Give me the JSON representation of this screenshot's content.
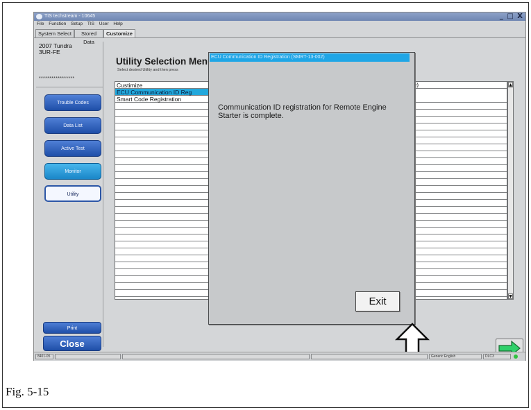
{
  "window": {
    "title": "TIS techstream - 10645",
    "controls": "_ □ X"
  },
  "menu": [
    "File",
    "Function",
    "Setup",
    "TIS",
    "User",
    "Help"
  ],
  "tabs": [
    "System Select",
    "Stored Data",
    "Customize"
  ],
  "vehicle": {
    "model": "2007 Tundra",
    "engine": "3UR-FE",
    "vin": "*****************"
  },
  "left_buttons": {
    "trouble_codes": "Trouble Codes",
    "data_list": "Data List",
    "active_test": "Active Test",
    "monitor": "Monitor",
    "utility": "Utility",
    "print": "Print",
    "close": "Close"
  },
  "utility": {
    "title": "Utility Selection Menu",
    "subtitle": "Select desired Utility and then press"
  },
  "list_items": [
    "Custimize",
    "ECU Communication ID Reg",
    "Smart Code Registration"
  ],
  "mode_text": "Mode)",
  "dialog": {
    "title": "ECU Communication ID Registration (SMRT-13-002)",
    "message": "Communication ID registration for Remote Engine Starter is complete.",
    "exit_label": "Exit"
  },
  "status": {
    "left": "8401-05",
    "language": "Generic English",
    "port": "DLC3"
  },
  "caption": "Fig. 5-15",
  "colors": {
    "dialog_title_bg": "#1fa6e6",
    "selected_row_bg": "#22a8dc",
    "button_blue": "#1f4fa8",
    "status_led": "#2fc23f"
  }
}
